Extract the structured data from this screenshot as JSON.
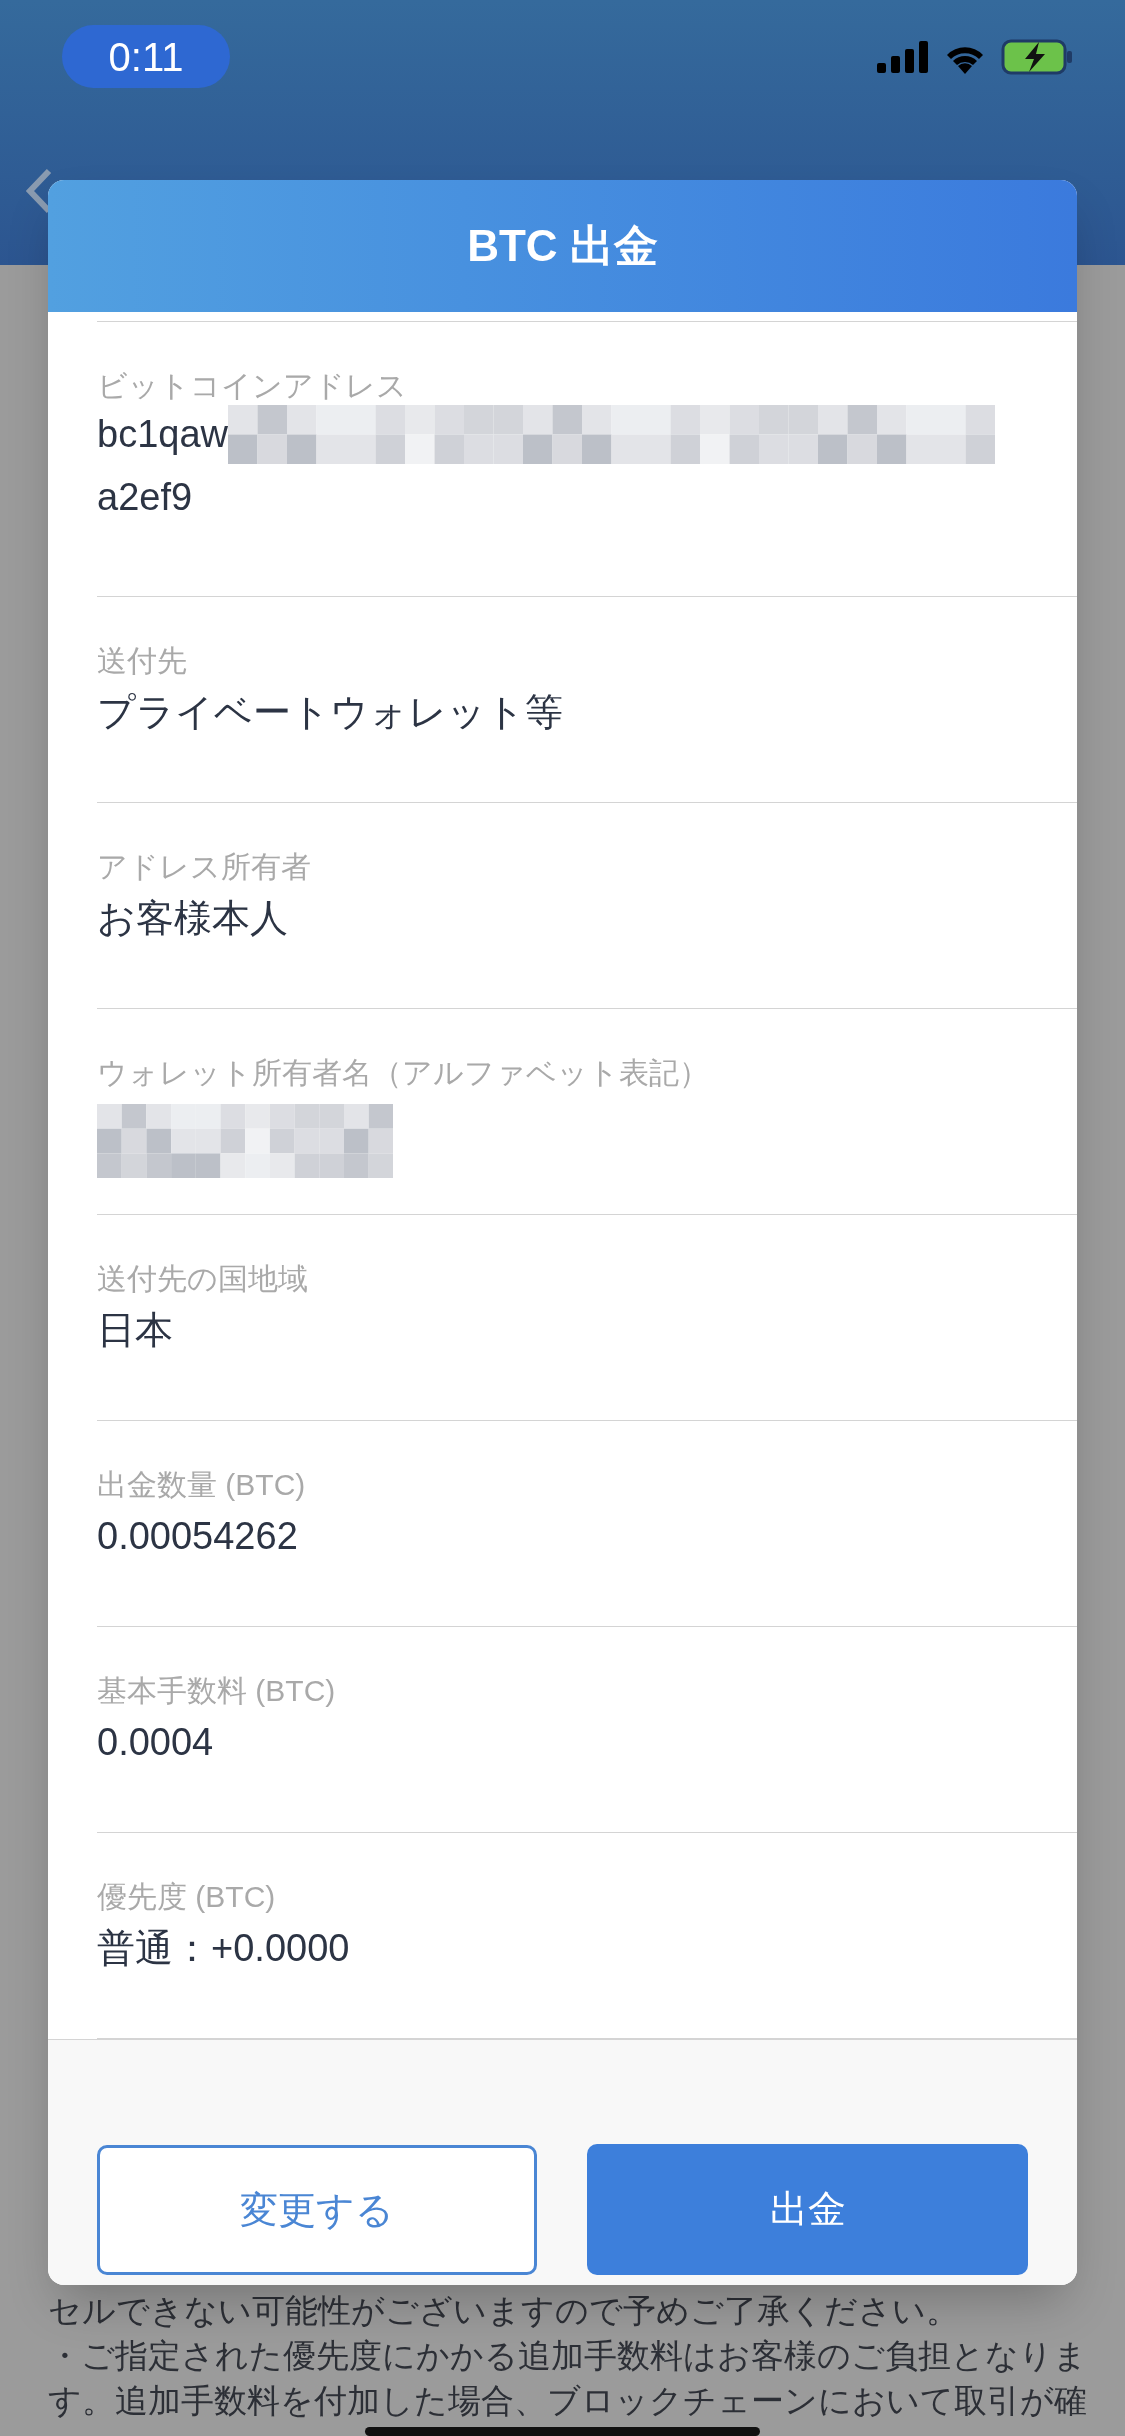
{
  "status_bar": {
    "time": "0:11"
  },
  "dialog": {
    "title": "BTC 出金",
    "fields": [
      {
        "kind": "address",
        "label": "ビットコインアドレス",
        "value_start": "bc1qaw",
        "value_end": "a2ef9"
      },
      {
        "kind": "text",
        "label": "送付先",
        "value": "プライベートウォレット等"
      },
      {
        "kind": "text",
        "label": "アドレス所有者",
        "value": "お客様本人"
      },
      {
        "kind": "redacted",
        "label": "ウォレット所有者名（アルファベット表記）"
      },
      {
        "kind": "text",
        "label": "送付先の国地域",
        "value": "日本"
      },
      {
        "kind": "text",
        "label": "出金数量 (BTC)",
        "value": "0.00054262"
      },
      {
        "kind": "text",
        "label": "基本手数料 (BTC)",
        "value": "0.0004"
      },
      {
        "kind": "text",
        "label": "優先度 (BTC)",
        "value": "普通：+0.0000"
      }
    ],
    "buttons": [
      {
        "kind": "outline",
        "label": "変更する"
      },
      {
        "kind": "primary",
        "label": "出金"
      }
    ]
  },
  "background_notes": [
    "セルできない可能性がございますので予めご了承ください。",
    "・ご指定された優先度にかかる追加手数料はお客様のご負担となりま",
    "す。追加手数料を付加した場合、ブロックチェーンにおいて取引が確"
  ]
}
